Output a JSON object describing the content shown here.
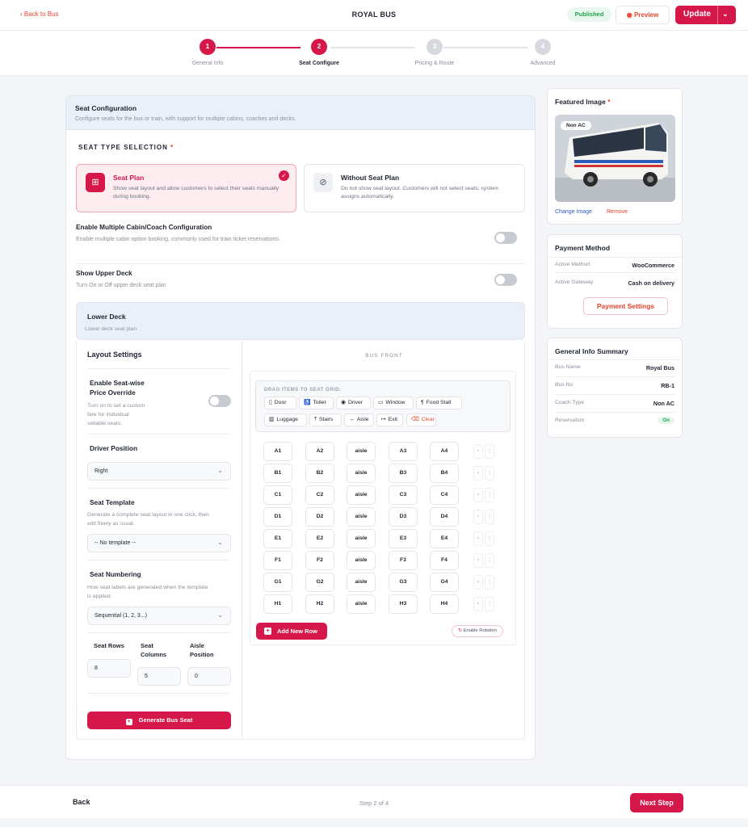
{
  "header": {
    "back_label": "Back to Bus",
    "title": "ROYAL BUS",
    "status_badge": "Published",
    "preview_label": "Preview",
    "update_label": "Update"
  },
  "stepper": {
    "steps": [
      {
        "num": "1",
        "label": "General Info"
      },
      {
        "num": "2",
        "label": "Seat Configure"
      },
      {
        "num": "3",
        "label": "Pricing & Route"
      },
      {
        "num": "4",
        "label": "Advanced"
      }
    ]
  },
  "seat_config": {
    "title": "Seat Configuration",
    "subtitle": "Configure seats for the bus or train, with support for multiple cabins, coaches and decks.",
    "type_heading": "SEAT TYPE SELECTION",
    "required_mark": "*",
    "seat_plan": {
      "title": "Seat Plan",
      "desc": "Show seat layout and allow customers to select their seats manually during booking."
    },
    "without_plan": {
      "title": "Without Seat Plan",
      "desc": "Do not show seat layout. Customers will not select seats; system assigns automatically."
    },
    "multi_cabin": {
      "title": "Enable Multiple Cabin/Coach Configuration",
      "desc": "Enable multiple cabin option booking, commonly used for train ticket reservations."
    },
    "upper_deck": {
      "title": "Show Upper Deck",
      "desc": "Turn On or Off upper deck seat plan"
    },
    "lower_deck": {
      "title": "Lower Deck",
      "desc": "Lower deck seat plan"
    }
  },
  "layout_settings": {
    "title": "Layout Settings",
    "price_override": {
      "title_1": "Enable Seat-wise",
      "title_2": "Price Override",
      "desc_1": "Turn on to set a custom",
      "desc_2": "fare for individual",
      "desc_3": "sellable seats."
    },
    "driver_position": {
      "title": "Driver Position",
      "value": "Right"
    },
    "seat_template": {
      "title": "Seat Template",
      "desc_1": "Generate a complete seat layout in one click, then",
      "desc_2": "edit freely as usual.",
      "value": "-- No template --"
    },
    "seat_numbering": {
      "title": "Seat Numbering",
      "desc_1": "How seat labels are generated when the template",
      "desc_2": "is applied.",
      "value": "Sequential (1, 2, 3...)"
    },
    "seat_rows": {
      "label": "Seat Rows",
      "value": "8"
    },
    "seat_columns": {
      "label_1": "Seat",
      "label_2": "Columns",
      "value": "5"
    },
    "aisle_position": {
      "label_1": "Aisle",
      "label_2": "Position",
      "value": "0"
    },
    "generate_label": "Generate Bus Seat"
  },
  "grid": {
    "bus_front": "BUS FRONT",
    "drag_label": "DRAG ITEMS TO SEAT GRID:",
    "items_row1": [
      {
        "icon": "door-icon",
        "glyph": "▯",
        "label": "Door"
      },
      {
        "icon": "toilet-icon",
        "glyph": "♿",
        "label": "Toilet"
      },
      {
        "icon": "driver-icon",
        "glyph": "◉",
        "label": "Driver"
      },
      {
        "icon": "window-icon",
        "glyph": "▭",
        "label": "Window"
      },
      {
        "icon": "food-stall-icon",
        "glyph": "¶",
        "label": "Food Stall"
      }
    ],
    "items_row2": [
      {
        "icon": "luggage-icon",
        "glyph": "▥",
        "label": "Luggage"
      },
      {
        "icon": "stairs-icon",
        "glyph": "⤒",
        "label": "Stairs"
      },
      {
        "icon": "aisle-icon",
        "glyph": "↔",
        "label": "Aisle"
      },
      {
        "icon": "exit-icon",
        "glyph": "↦",
        "label": "Exit"
      },
      {
        "icon": "clear-icon",
        "glyph": "⌫",
        "label": "Clear"
      }
    ],
    "rows": [
      [
        "A1",
        "A2",
        "aisle",
        "A3",
        "A4"
      ],
      [
        "B1",
        "B2",
        "aisle",
        "B3",
        "B4"
      ],
      [
        "C1",
        "C2",
        "aisle",
        "C3",
        "C4"
      ],
      [
        "D1",
        "D2",
        "aisle",
        "D3",
        "D4"
      ],
      [
        "E1",
        "E2",
        "aisle",
        "E3",
        "E4"
      ],
      [
        "F1",
        "F2",
        "aisle",
        "F3",
        "F4"
      ],
      [
        "G1",
        "G2",
        "aisle",
        "G3",
        "G4"
      ],
      [
        "H1",
        "H2",
        "aisle",
        "H3",
        "H4"
      ]
    ],
    "add_row_label": "Add New Row",
    "rotation_label": "Enable Rotation"
  },
  "featured": {
    "title": "Featured Image",
    "badge": "Non AC",
    "change_label": "Change Image",
    "remove_label": "Remove"
  },
  "payment": {
    "title": "Payment Method",
    "active_method_label": "Active Method",
    "active_method_value": "WooCommerce",
    "gateway_label": "Active Gateway",
    "gateway_value": "Cash on delivery",
    "settings_label": "Payment Settings"
  },
  "summary": {
    "title": "General Info Summary",
    "items": [
      {
        "label": "Bus Name",
        "value": "Royal Bus"
      },
      {
        "label": "Bus No",
        "value": "RB-1"
      },
      {
        "label": "Coach Type",
        "value": "Non AC"
      },
      {
        "label": "Reservation",
        "value": "On"
      }
    ]
  },
  "footer": {
    "back_label": "Back",
    "step_text": "Step 2 of 4",
    "next_label": "Next Step"
  },
  "colors": {
    "primary": "#d6174a",
    "accent": "#e8432e",
    "success": "#1fa34a"
  }
}
